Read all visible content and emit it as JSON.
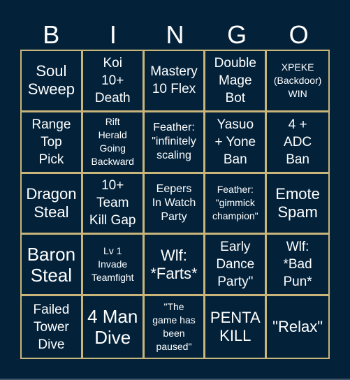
{
  "header": {
    "letters": [
      "B",
      "I",
      "N",
      "G",
      "O"
    ]
  },
  "colors": {
    "background": "#03223a",
    "grid_line": "#c9b57a",
    "text": "#ffffff"
  },
  "cells": [
    {
      "text": "Soul\nSweep",
      "size": "l"
    },
    {
      "text": "Koi\n10+\nDeath",
      "size": "m"
    },
    {
      "text": "Mastery\n10 Flex",
      "size": "m"
    },
    {
      "text": "Double\nMage\nBot",
      "size": "m"
    },
    {
      "text": "XPEKE\n(Backdoor)\nWIN",
      "size": "xs"
    },
    {
      "text": "Range\nTop\nPick",
      "size": "m"
    },
    {
      "text": "Rift\nHerald\nGoing\nBackward",
      "size": "xs"
    },
    {
      "text": "Feather:\n\"infinitely\nscaling",
      "size": "s"
    },
    {
      "text": "Yasuo\n+ Yone\nBan",
      "size": "m"
    },
    {
      "text": "4 +\nADC\nBan",
      "size": "m"
    },
    {
      "text": "Dragon\nSteal",
      "size": "l"
    },
    {
      "text": "10+\nTeam\nKill Gap",
      "size": "m"
    },
    {
      "text": "Eepers\nIn Watch\nParty",
      "size": "s"
    },
    {
      "text": "Feather:\n\"gimmick\nchampion\"",
      "size": "xs"
    },
    {
      "text": "Emote\nSpam",
      "size": "l"
    },
    {
      "text": "Baron\nSteal",
      "size": "xl"
    },
    {
      "text": "Lv 1\nInvade\nTeamfight",
      "size": "xs"
    },
    {
      "text": "Wlf:\n*Farts*",
      "size": "l"
    },
    {
      "text": "Early\nDance\nParty\"",
      "size": "m"
    },
    {
      "text": "Wlf:\n*Bad\nPun*",
      "size": "m"
    },
    {
      "text": "Failed\nTower\nDive",
      "size": "m"
    },
    {
      "text": "4 Man\nDive",
      "size": "xl"
    },
    {
      "text": "\"The\ngame has\nbeen\npaused\"",
      "size": "xs"
    },
    {
      "text": "PENTA\nKILL",
      "size": "l"
    },
    {
      "text": "\"Relax\"",
      "size": "l"
    }
  ]
}
